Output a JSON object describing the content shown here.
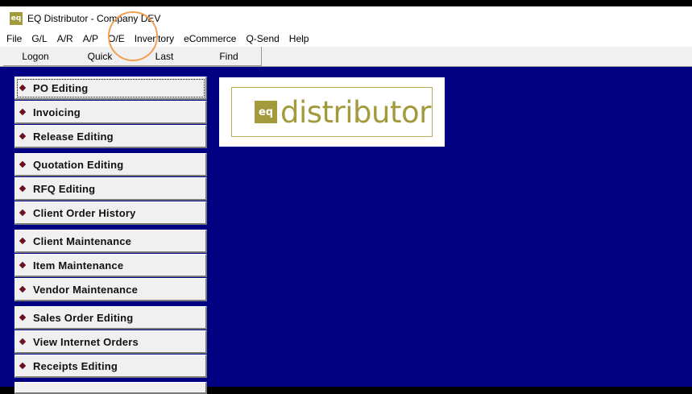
{
  "window": {
    "title": "EQ Distributor - Company DEV",
    "icon_text": "eq"
  },
  "menu": [
    "File",
    "G/L",
    "A/R",
    "A/P",
    "O/E",
    "Inventory",
    "eCommerce",
    "Q-Send",
    "Help"
  ],
  "toolbar": {
    "logon": "Logon",
    "quick": "Quick",
    "last": "Last",
    "find": "Find"
  },
  "nav": {
    "items": [
      "PO Editing",
      "Invoicing",
      "Release Editing",
      "Quotation Editing",
      "RFQ Editing",
      "Client Order History",
      "Client Maintenance",
      "Item Maintenance",
      "Vendor Maintenance",
      "Sales Order Editing",
      "View Internet Orders",
      "Receipts Editing"
    ]
  },
  "logo": {
    "mark": "eq",
    "word": "distributor"
  },
  "colors": {
    "background": "#000080",
    "brand": "#a39a3c",
    "highlight": "#f0a050"
  }
}
